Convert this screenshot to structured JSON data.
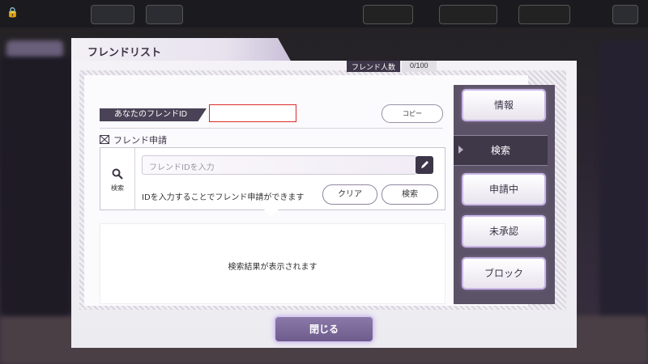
{
  "dialog": {
    "title": "フレンドリスト",
    "friend_count_label": "フレンド人数",
    "friend_count_value": "0/100",
    "my_id_label": "あなたのフレンドID",
    "my_id_value": "",
    "copy_label": "コピー",
    "request_title": "フレンド申請",
    "search_side_label": "検索",
    "id_input_placeholder": "フレンドIDを入力",
    "hint": "IDを入力することでフレンド申請ができます",
    "clear_label": "クリア",
    "search_label": "検索",
    "results_text": "検索結果が表示されます",
    "close_label": "閉じる"
  },
  "tabs": [
    {
      "label": "情報",
      "active": false
    },
    {
      "label": "検索",
      "active": true
    },
    {
      "label": "申請中",
      "active": false
    },
    {
      "label": "未承認",
      "active": false
    },
    {
      "label": "ブロック",
      "active": false
    }
  ],
  "colors": {
    "accent": "#3d3648",
    "highlight": "#c9b7e6",
    "error_border": "#e02a2a"
  }
}
